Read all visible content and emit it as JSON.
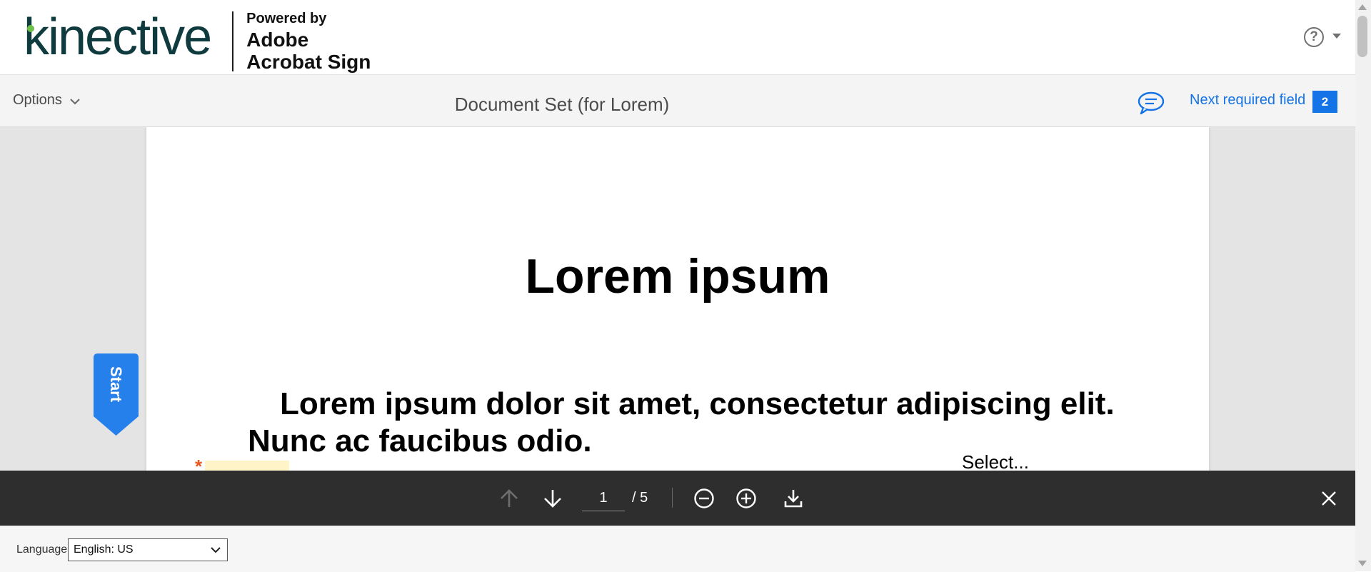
{
  "header": {
    "brand": "kinective",
    "powered_by": "Powered by",
    "powered_line1": "Adobe",
    "powered_line2": "Acrobat Sign",
    "help_symbol": "?"
  },
  "toolbar": {
    "options_label": "Options",
    "document_title": "Document Set (for Lorem)",
    "next_required_label": "Next required field",
    "required_count": "2"
  },
  "document": {
    "heading": "Lorem ipsum",
    "paragraph": "Lorem ipsum dolor sit amet, consectetur adipiscing elit. Nunc ac faucibus odio.",
    "required_marker": "*",
    "select_placeholder": "Select..."
  },
  "start_tab": {
    "label": "Start"
  },
  "viewer": {
    "current_page": "1",
    "total_pages": "/ 5"
  },
  "footer": {
    "language_label": "Language",
    "language_value": "English: US"
  },
  "colors": {
    "accent": "#1473e6",
    "viewer_bar": "#2e2e2e",
    "brand_text": "#0f3b3f",
    "brand_dot": "#6cc04a",
    "required_field_bg": "#fff4c7",
    "required_star": "#e8581c"
  },
  "icons": [
    "help-icon",
    "chevron-down-icon",
    "comment-icon",
    "arrow-up-icon",
    "arrow-down-icon",
    "zoom-out-icon",
    "zoom-in-icon",
    "download-icon",
    "close-icon"
  ]
}
